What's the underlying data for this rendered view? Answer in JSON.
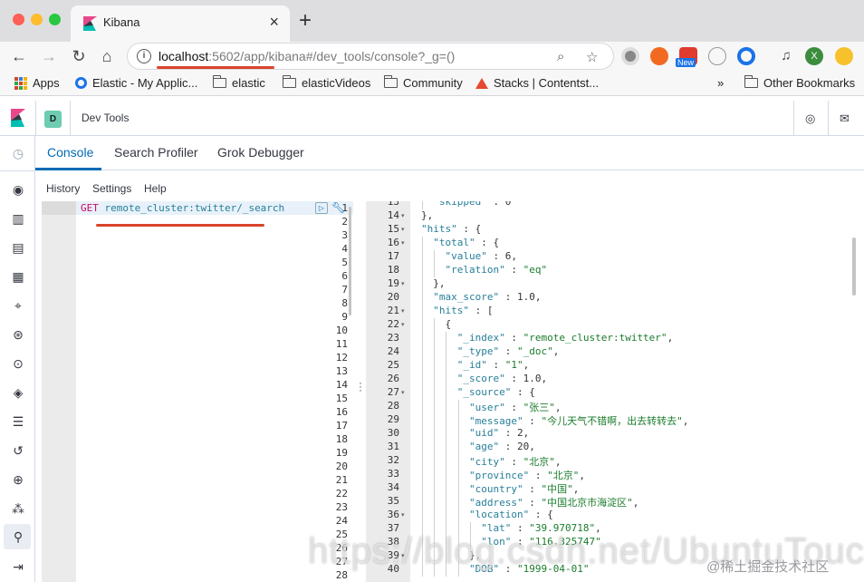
{
  "browser": {
    "tab_title": "Kibana",
    "url_host": "localhost",
    "url_rest": ":5602/app/kibana#/dev_tools/console?_g=()",
    "new_badge": "New",
    "profile_initial": "X",
    "bookmarks": [
      "Apps",
      "Elastic - My Applic...",
      "elastic",
      "elasticVideos",
      "Community",
      "Stacks | Contentst...",
      "»",
      "Other Bookmarks"
    ]
  },
  "kibana": {
    "space_initial": "D",
    "app_title": "Dev Tools",
    "tabs": [
      "Console",
      "Search Profiler",
      "Grok Debugger"
    ],
    "console_menu": [
      "History",
      "Settings",
      "Help"
    ]
  },
  "editor": {
    "method": "GET",
    "path": "remote_cluster:twitter/_search",
    "line_numbers": [
      "1",
      "2",
      "3",
      "4",
      "5",
      "6",
      "7",
      "8",
      "9",
      "10",
      "11",
      "12",
      "13",
      "14",
      "15",
      "16",
      "17",
      "18",
      "19",
      "20",
      "21",
      "22",
      "23",
      "24",
      "25",
      "26",
      "27",
      "28"
    ]
  },
  "output": {
    "lines": [
      {
        "n": "13",
        "t": "  \"skipped\" : 0"
      },
      {
        "n": "14",
        "t": "},",
        "fold": true
      },
      {
        "n": "15",
        "t": "\"hits\" : {",
        "fold": true
      },
      {
        "n": "16",
        "t": "  \"total\" : {",
        "fold": true
      },
      {
        "n": "17",
        "t": "    \"value\" : 6,"
      },
      {
        "n": "18",
        "t": "    \"relation\" : \"eq\""
      },
      {
        "n": "19",
        "t": "  },",
        "fold": true
      },
      {
        "n": "20",
        "t": "  \"max_score\" : 1.0,"
      },
      {
        "n": "21",
        "t": "  \"hits\" : [",
        "fold": true
      },
      {
        "n": "22",
        "t": "    {",
        "fold": true
      },
      {
        "n": "23",
        "t": "      \"_index\" : \"remote_cluster:twitter\","
      },
      {
        "n": "24",
        "t": "      \"_type\" : \"_doc\","
      },
      {
        "n": "25",
        "t": "      \"_id\" : \"1\","
      },
      {
        "n": "26",
        "t": "      \"_score\" : 1.0,"
      },
      {
        "n": "27",
        "t": "      \"_source\" : {",
        "fold": true
      },
      {
        "n": "28",
        "t": "        \"user\" : \"张三\","
      },
      {
        "n": "29",
        "t": "        \"message\" : \"今儿天气不错啊，出去转转去\","
      },
      {
        "n": "30",
        "t": "        \"uid\" : 2,"
      },
      {
        "n": "31",
        "t": "        \"age\" : 20,"
      },
      {
        "n": "32",
        "t": "        \"city\" : \"北京\","
      },
      {
        "n": "33",
        "t": "        \"province\" : \"北京\","
      },
      {
        "n": "34",
        "t": "        \"country\" : \"中国\","
      },
      {
        "n": "35",
        "t": "        \"address\" : \"中国北京市海淀区\","
      },
      {
        "n": "36",
        "t": "        \"location\" : {",
        "fold": true
      },
      {
        "n": "37",
        "t": "          \"lat\" : \"39.970718\","
      },
      {
        "n": "38",
        "t": "          \"lon\" : \"116.325747\""
      },
      {
        "n": "39",
        "t": "        },",
        "fold": true
      },
      {
        "n": "40",
        "t": "        \"DOB\" : \"1999-04-01\""
      }
    ]
  },
  "watermark": "https://blog.csdn.net/UbuntuTouch",
  "watermark_brand": "@稀土掘金技术社区",
  "colors": {
    "accent": "#006bb4",
    "annotation_red": "#d9442c",
    "space_avatar": "#6dccb1"
  }
}
